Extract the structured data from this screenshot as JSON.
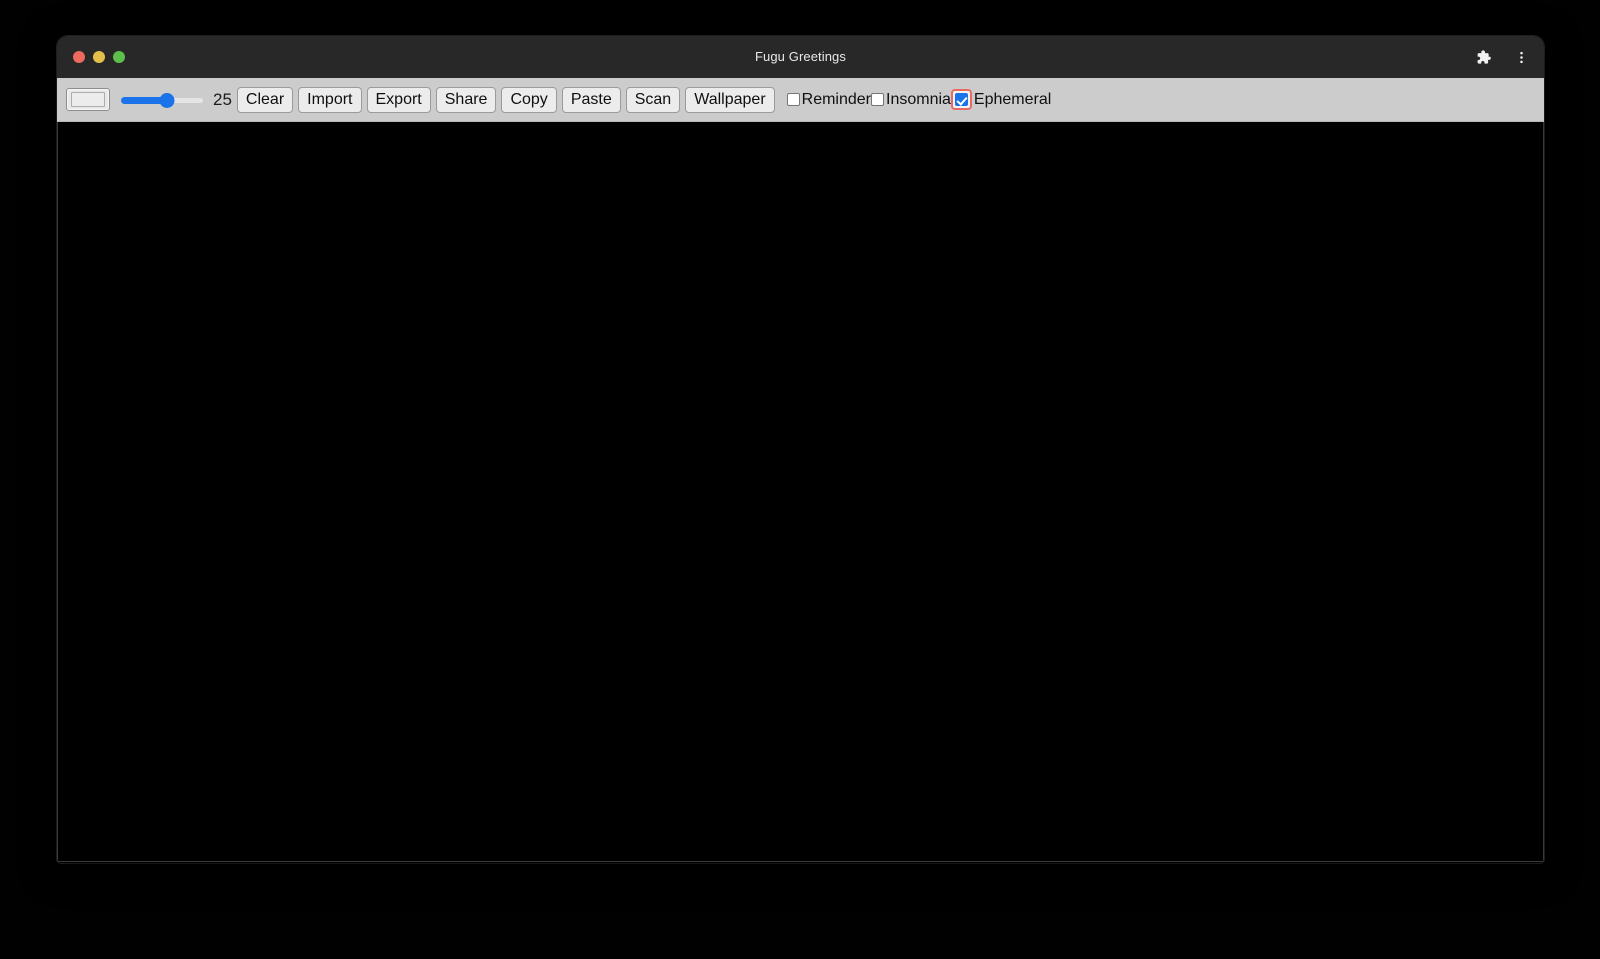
{
  "window": {
    "title": "Fugu Greetings",
    "traffic_lights": [
      {
        "name": "close",
        "color": "#ED6A5E"
      },
      {
        "name": "minimize",
        "color": "#E4C04B"
      },
      {
        "name": "maximize",
        "color": "#5DC04A"
      }
    ],
    "title_actions": [
      {
        "name": "extensions-icon",
        "label": "Extensions"
      },
      {
        "name": "more-menu-icon",
        "label": "More"
      }
    ]
  },
  "toolbar": {
    "color_picker": {
      "label": "Color",
      "value": "#ececec"
    },
    "slider": {
      "label": "Line width",
      "value": 25,
      "min": 1,
      "max": 50,
      "display_value": "25",
      "fill_percent": 55,
      "accent_color": "#1a73e8"
    },
    "buttons": [
      {
        "name": "clear-button",
        "label": "Clear"
      },
      {
        "name": "import-button",
        "label": "Import"
      },
      {
        "name": "export-button",
        "label": "Export"
      },
      {
        "name": "share-button",
        "label": "Share"
      },
      {
        "name": "copy-button",
        "label": "Copy"
      },
      {
        "name": "paste-button",
        "label": "Paste"
      },
      {
        "name": "scan-button",
        "label": "Scan"
      },
      {
        "name": "wallpaper-button",
        "label": "Wallpaper"
      }
    ],
    "checkboxes": [
      {
        "name": "reminder-checkbox",
        "label": "Reminder",
        "checked": false,
        "focused": false
      },
      {
        "name": "insomnia-checkbox",
        "label": "Insomnia",
        "checked": false,
        "focused": false
      },
      {
        "name": "ephemeral-checkbox",
        "label": "Ephemeral",
        "checked": true,
        "focused": true
      }
    ]
  },
  "canvas": {
    "name": "drawing-canvas",
    "background_color": "#000000"
  },
  "colors": {
    "titlebar_bg": "#282829",
    "toolbar_bg": "#CCCCCC",
    "accent": "#1a73e8",
    "focus_ring": "#e96a63",
    "canvas_bg": "#000000"
  }
}
